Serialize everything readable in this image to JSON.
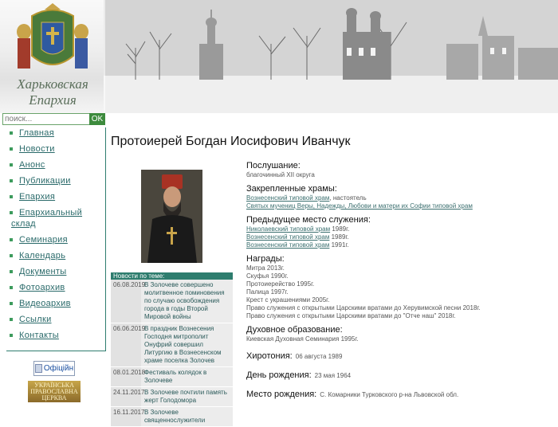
{
  "header": {
    "site_title_line1": "Харьковская",
    "site_title_line2": "Епархия"
  },
  "search": {
    "placeholder": "поиск...",
    "button_label": "OK"
  },
  "nav": {
    "items": [
      {
        "label": "Главная"
      },
      {
        "label": "Новости"
      },
      {
        "label": "Анонс"
      },
      {
        "label": "Публикации"
      },
      {
        "label": "Епархия"
      },
      {
        "label": "Епархиальный склад"
      },
      {
        "label": "Семинария"
      },
      {
        "label": "Календарь"
      },
      {
        "label": "Документы"
      },
      {
        "label": "Фотоархив"
      },
      {
        "label": "Видеоархив"
      },
      {
        "label": "Ссылки"
      },
      {
        "label": "Контакты"
      }
    ]
  },
  "official": {
    "label": "Офіційн"
  },
  "banner": {
    "text": "УКРАЇНСЬКА ПРАВОСЛАВНА ЦЕРКВА"
  },
  "main": {
    "title": "Протоиерей Богдан Иосифович Иванчук"
  },
  "news": {
    "header": "Новости по теме:",
    "items": [
      {
        "date": "06.08.2019",
        "text": "В Золочеве совершено молитвенное поминовения по случаю освобождения города в годы Второй Мировой войны"
      },
      {
        "date": "06.06.2019",
        "text": "В праздник Вознесения Господня митрополит Онуфрий совершил Литургию в Вознесенском храме поселка Золочев"
      },
      {
        "date": "08.01.2018",
        "text": "Фестиваль колядок в Золочеве"
      },
      {
        "date": "24.11.2017",
        "text": "В Золочеве почтили память жерт Голодомора"
      },
      {
        "date": "16.11.2017",
        "text": "В Золочеве священнослужители"
      }
    ]
  },
  "info": {
    "obedience": {
      "label": "Послушание:",
      "value": "благочинный XII округа"
    },
    "churches": {
      "label": "Закрепленные храмы:",
      "line1_link": "Вознесенский типовой храм",
      "line1_suffix": ", настоятель",
      "line2_link": "Святых мучениц Веры, Надежды, Любови и матери их Софии типовой храм"
    },
    "previous": {
      "label": "Предыдущее место служения:",
      "items": [
        {
          "link": "Николаевский типовой храм",
          "year": " 1989г."
        },
        {
          "link": "Вознесенский типовой храм",
          "year": " 1989г."
        },
        {
          "link": "Вознесенский типовой храм",
          "year": " 1991г."
        }
      ]
    },
    "awards": {
      "label": "Награды:",
      "items": [
        "Митра 2013г.",
        "Скуфья 1990г.",
        "Протоиерейство 1995г.",
        "Палица 1997г.",
        "Крест с украшениями 2005г.",
        "Право служения с открытыми Царскими вратами до Херувимской песни 2018г.",
        "Право служения с открытыми Царскими вратами до \"Отче наш\" 2018г."
      ]
    },
    "education": {
      "label": "Духовное образование:",
      "value": "Киевская Духовная Семинария 1995г."
    },
    "ordination": {
      "label": "Хиротония:",
      "value": "06 августа 1989"
    },
    "birthday": {
      "label": "День рождения:",
      "value": "23 мая 1964"
    },
    "birthplace": {
      "label": "Место рождения:",
      "value": "С. Комарники Турковского р-на Львовской обл."
    }
  },
  "colors": {
    "accent": "#2e7d6e",
    "link": "#336666",
    "nav_bullet": "#3d9b5d"
  }
}
